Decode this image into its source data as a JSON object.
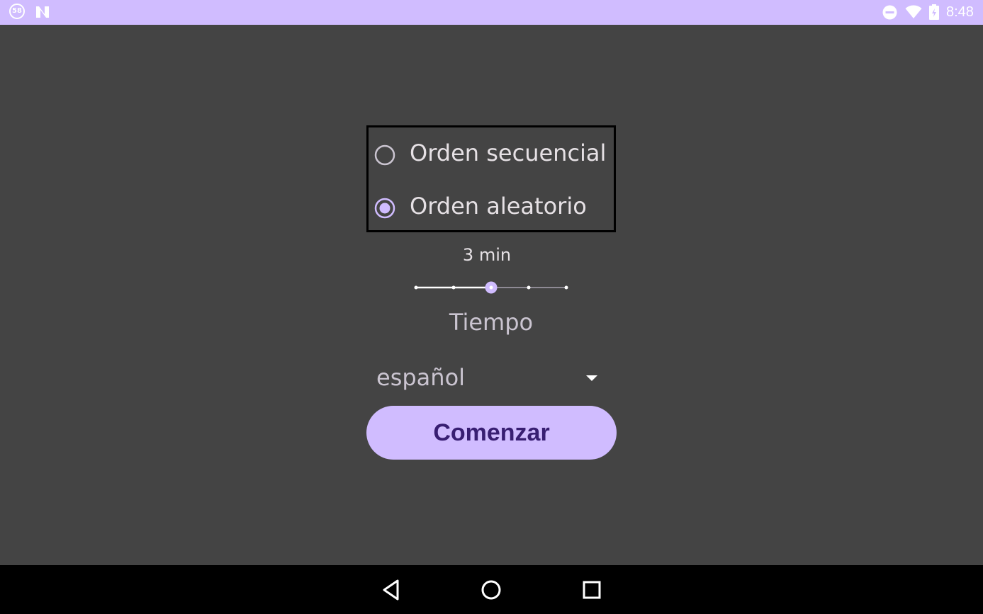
{
  "status_bar": {
    "notification_badge": "58",
    "time": "8:48",
    "icons": [
      "notification-58-icon",
      "n-app-icon",
      "do-not-disturb-icon",
      "wifi-icon",
      "battery-icon"
    ]
  },
  "radio_group": {
    "options": [
      {
        "label": "Orden secuencial",
        "checked": false
      },
      {
        "label": "Orden aleatorio",
        "checked": true
      }
    ]
  },
  "slider": {
    "value_label": "3 min",
    "steps": 5,
    "selected_index": 2
  },
  "tiempo_label": "Tiempo",
  "spinner": {
    "selected": "español"
  },
  "start_button": {
    "label": "Comenzar"
  },
  "nav_bar": {
    "icons": [
      "back-icon",
      "home-icon",
      "recents-icon"
    ]
  },
  "colors": {
    "accent": "#D0BCFF",
    "background": "#444444",
    "button_text": "#381E72",
    "nav_background": "#000000"
  }
}
